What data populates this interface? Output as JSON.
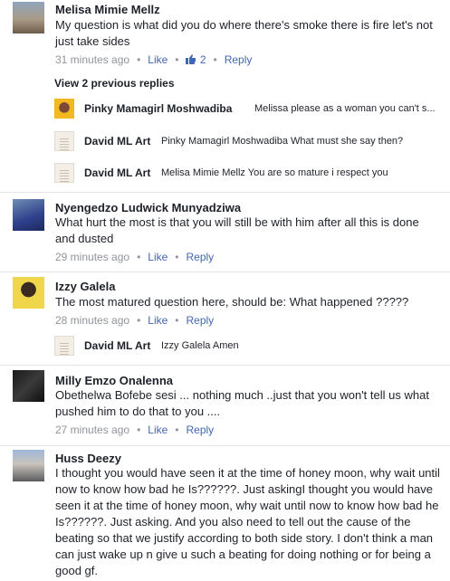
{
  "comments": [
    {
      "name": "Melisa Mimie Mellz",
      "text": "My question is what did you do where there's smoke there is fire let's not just take sides",
      "time": "31 minutes ago",
      "like": "Like",
      "likes": "2",
      "reply": "Reply",
      "avatar_icon": "landscape-avatar"
    },
    {
      "name": "Nyengedzo Ludwick Munyadziwa",
      "text": "What hurt the most is that you will still be with him after all this is done and dusted",
      "time": "29 minutes ago",
      "like": "Like",
      "reply": "Reply",
      "avatar_icon": "person-avatar"
    },
    {
      "name": "Izzy Galela",
      "text": "The most matured question here, should be: What happened ?????",
      "time": "28 minutes ago",
      "like": "Like",
      "reply": "Reply",
      "avatar_icon": "person-avatar"
    },
    {
      "name": "Milly Emzo Onalenna",
      "text": "Obethelwa Bofebe sesi ... nothing much ..just that you won't tell us what pushed him to do that to you ....",
      "time": "27 minutes ago",
      "like": "Like",
      "reply": "Reply",
      "avatar_icon": "dark-avatar"
    },
    {
      "name": "Huss Deezy",
      "text": "I thought you would have seen it at the time of honey moon, why wait until now to know how bad he Is??????. Just askingI thought you would have seen it at the time of honey moon, why wait until now to know how bad he Is??????. Just asking. And you also need to tell out the cause of the beating so that we justify according to both side story. I don't think a man can just wake up n give u such a beating for doing nothing or for being a good gf.",
      "avatar_icon": "street-avatar"
    }
  ],
  "view_previous": "View 2 previous replies",
  "replies_1": [
    {
      "name": "Pinky Mamagirl Moshwadiba",
      "text": "Melissa please as a woman you can't s..."
    },
    {
      "name": "David ML Art",
      "text": "Pinky Mamagirl Moshwadiba What must she say then?"
    },
    {
      "name": "David ML Art",
      "text": "Melisa Mimie Mellz You are so mature i respect you"
    }
  ],
  "replies_3": [
    {
      "name": "David ML Art",
      "text": "Izzy Galela Amen"
    }
  ],
  "colors": {
    "link": "#4267b2",
    "meta": "#90949c",
    "text": "#1d2129",
    "separator": "#e2e4e8"
  }
}
